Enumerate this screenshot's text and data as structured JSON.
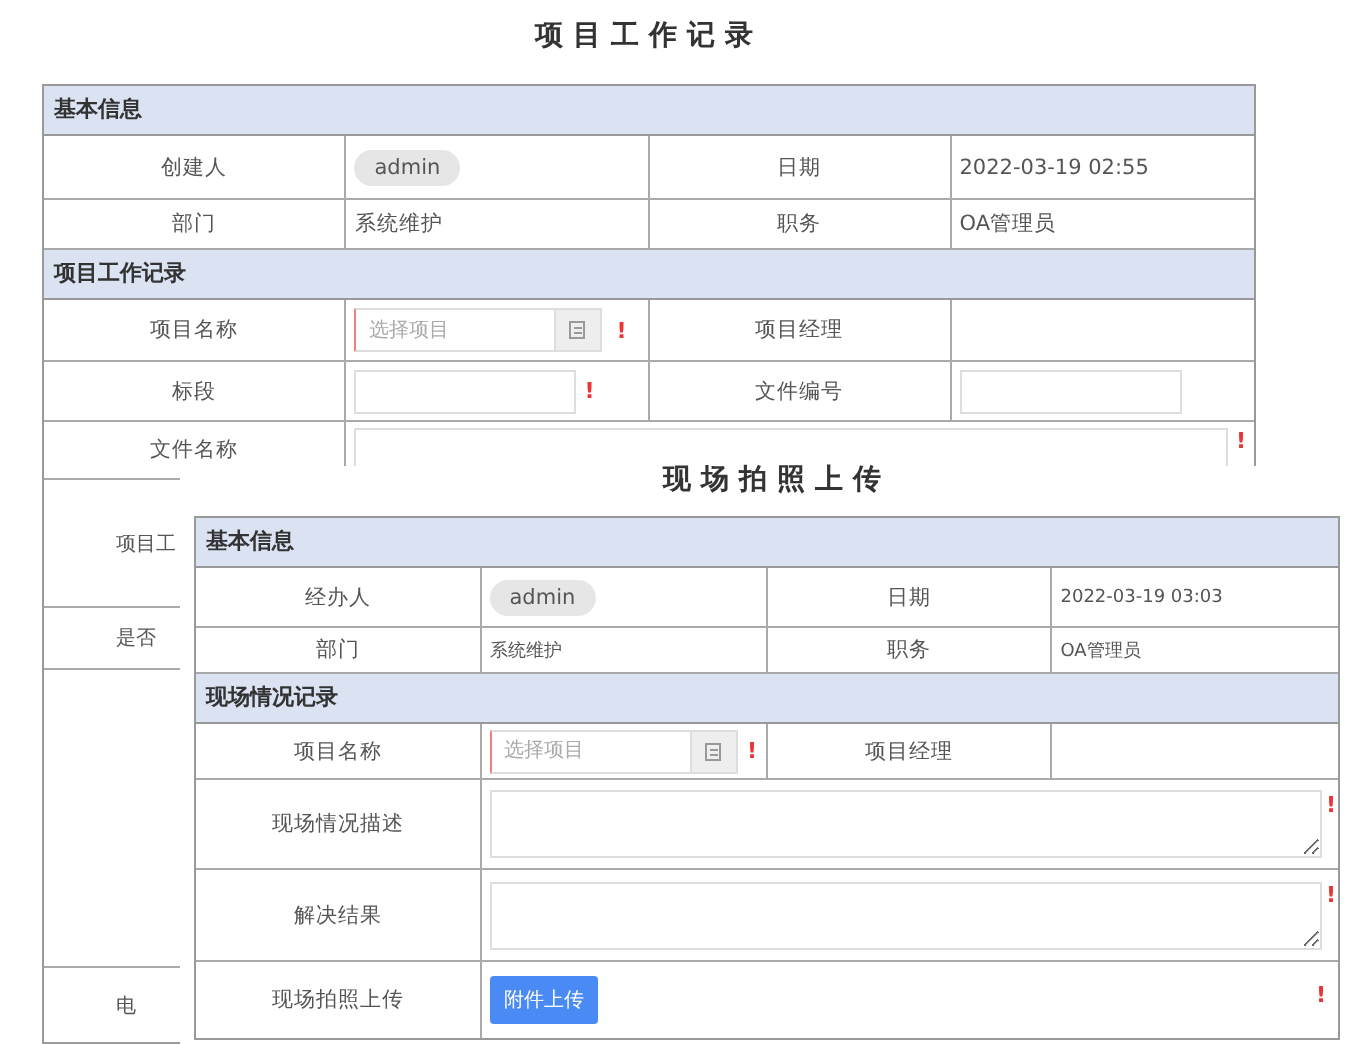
{
  "main_form": {
    "title": "项目工作记录",
    "sections": [
      {
        "header": "基本信息",
        "rows": [
          {
            "cells": [
              {
                "kind": "label",
                "text": "创建人"
              },
              {
                "kind": "chip",
                "text": "admin"
              },
              {
                "kind": "label",
                "text": "日期"
              },
              {
                "kind": "text",
                "text": "2022-03-19 02:55"
              }
            ]
          },
          {
            "cells": [
              {
                "kind": "label",
                "text": "部门"
              },
              {
                "kind": "text",
                "text": "系统维护"
              },
              {
                "kind": "label",
                "text": "职务"
              },
              {
                "kind": "text",
                "text": "OA管理员"
              }
            ]
          }
        ]
      },
      {
        "header": "项目工作记录",
        "rows": [
          {
            "cells": [
              {
                "kind": "label",
                "text": "项目名称"
              },
              {
                "kind": "select",
                "placeholder": "选择项目",
                "flag": "!"
              },
              {
                "kind": "label",
                "text": "项目经理"
              },
              {
                "kind": "blank"
              }
            ]
          },
          {
            "cells": [
              {
                "kind": "label",
                "text": "标段"
              },
              {
                "kind": "input",
                "flag": "!"
              },
              {
                "kind": "label",
                "text": "文件编号"
              },
              {
                "kind": "input"
              }
            ]
          },
          {
            "cells": [
              {
                "kind": "label",
                "text": "文件名称"
              },
              {
                "kind": "wideinput",
                "flag": "!"
              }
            ]
          },
          {
            "cells": [
              {
                "kind": "cutlabel",
                "text": "项目工"
              }
            ]
          },
          {
            "cells": [
              {
                "kind": "cutlabel",
                "text": "是否"
              }
            ]
          },
          {
            "cells": [
              {
                "kind": "blank"
              }
            ]
          },
          {
            "cells": [
              {
                "kind": "cutlabel",
                "text": "电"
              }
            ]
          }
        ]
      }
    ]
  },
  "dialog": {
    "title": "现场拍照上传",
    "sections": [
      {
        "header": "基本信息",
        "rows": [
          {
            "cells": [
              {
                "kind": "label",
                "text": "经办人"
              },
              {
                "kind": "chip",
                "text": "admin"
              },
              {
                "kind": "label",
                "text": "日期"
              },
              {
                "kind": "text",
                "text": "2022-03-19 03:03"
              }
            ]
          },
          {
            "cells": [
              {
                "kind": "label",
                "text": "部门"
              },
              {
                "kind": "text",
                "text": "系统维护"
              },
              {
                "kind": "label",
                "text": "职务"
              },
              {
                "kind": "text",
                "text": "OA管理员"
              }
            ]
          }
        ]
      },
      {
        "header": "现场情况记录",
        "rows": [
          {
            "cells": [
              {
                "kind": "label",
                "text": "项目名称"
              },
              {
                "kind": "select",
                "placeholder": "选择项目",
                "flag": "!"
              },
              {
                "kind": "label",
                "text": "项目经理"
              },
              {
                "kind": "blank"
              }
            ]
          },
          {
            "cells": [
              {
                "kind": "label",
                "text": "现场情况描述"
              },
              {
                "kind": "textarea",
                "flag": "!"
              }
            ]
          },
          {
            "cells": [
              {
                "kind": "label",
                "text": "解决结果"
              },
              {
                "kind": "textarea",
                "flag": "!"
              }
            ]
          },
          {
            "cells": [
              {
                "kind": "label",
                "text": "现场拍照上传"
              },
              {
                "kind": "button",
                "text": "附件上传",
                "flag": "!"
              }
            ]
          }
        ]
      }
    ]
  }
}
